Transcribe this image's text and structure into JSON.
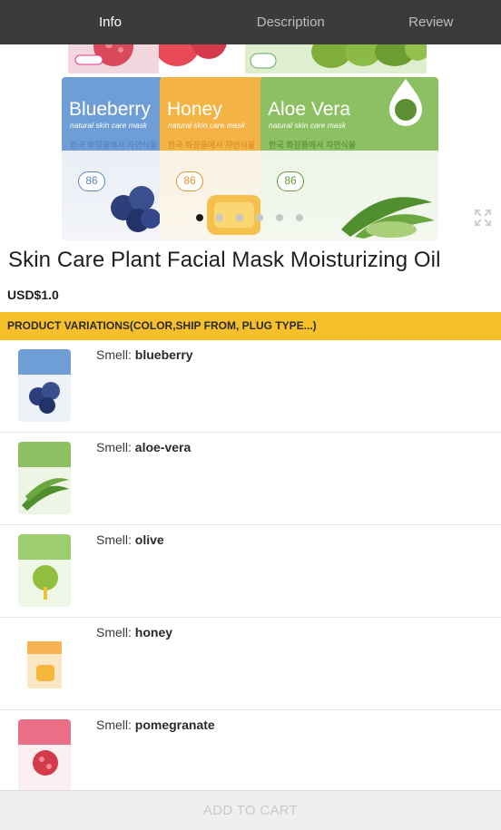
{
  "tabs": [
    {
      "label": "Info",
      "active": true
    },
    {
      "label": "Description",
      "active": false
    },
    {
      "label": "Review",
      "active": false
    }
  ],
  "hero": {
    "packs": [
      {
        "brand": "Blueberry",
        "sub": "natural skin care mask",
        "korean": "한국 화장품에서 자연식물",
        "num": "86",
        "color": "#6f9ed6"
      },
      {
        "brand": "Honey",
        "sub": "natural skin care mask",
        "korean": "한국 화장품에서 자연식물",
        "num": "86",
        "color": "#f4b445"
      },
      {
        "brand": "Aloe Vera",
        "sub": "natural skin care mask",
        "korean": "한국 화장품에서 자연식물",
        "num": "86",
        "color": "#8cc063"
      }
    ],
    "carousel_total": 6,
    "carousel_active": 1
  },
  "product": {
    "title": "Skin Care Plant Facial Mask Moisturizing Oil",
    "price": "USD$1.0"
  },
  "variations": {
    "header": "PRODUCT VARIATIONS(COLOR,SHIP FROM, PLUG TYPE...)",
    "label_prefix": "Smell:",
    "items": [
      {
        "value": "blueberry",
        "color": "#6f9ed6"
      },
      {
        "value": "aloe-vera",
        "color": "#8cc063"
      },
      {
        "value": "olive",
        "color": "#9ccd6e"
      },
      {
        "value": "honey",
        "color": "#f6b454"
      },
      {
        "value": "pomegranate",
        "color": "#ea6f86"
      }
    ]
  },
  "cart": {
    "label": "ADD TO CART"
  },
  "icons": {
    "expand": "expand-icon"
  }
}
